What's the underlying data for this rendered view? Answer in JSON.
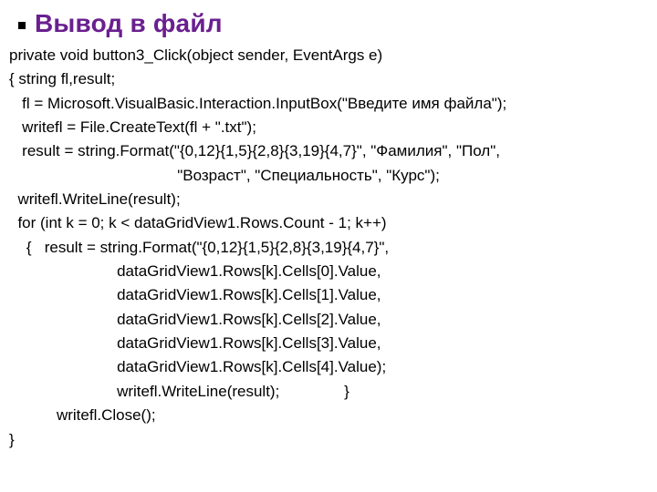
{
  "title": "Вывод в файл",
  "code": "private void button3_Click(object sender, EventArgs e)\n{ string fl,result;\n   fl = Microsoft.VisualBasic.Interaction.InputBox(\"Введите имя файла\");\n   writefl = File.CreateText(fl + \".txt\");\n   result = string.Format(\"{0,12}{1,5}{2,8}{3,19}{4,7}\", \"Фамилия\", \"Пол\",\n                                       \"Возраст\", \"Специальность\", \"Курс\");\n  writefl.WriteLine(result);\n  for (int k = 0; k < dataGridView1.Rows.Count - 1; k++)\n    {   result = string.Format(\"{0,12}{1,5}{2,8}{3,19}{4,7}\",\n                         dataGridView1.Rows[k].Cells[0].Value,\n                         dataGridView1.Rows[k].Cells[1].Value,\n                         dataGridView1.Rows[k].Cells[2].Value,\n                         dataGridView1.Rows[k].Cells[3].Value,\n                         dataGridView1.Rows[k].Cells[4].Value);\n                         writefl.WriteLine(result);               }\n           writefl.Close();\n}"
}
